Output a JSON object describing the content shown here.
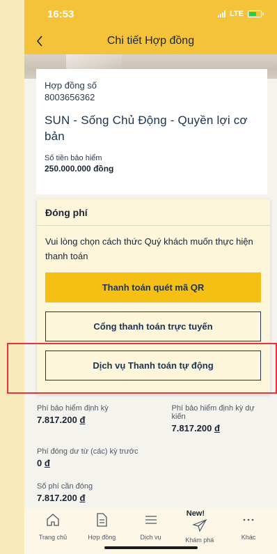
{
  "status_bar": {
    "time": "16:53",
    "network": "LTE"
  },
  "nav": {
    "title": "Chi tiết Hợp đồng"
  },
  "contract": {
    "number_label": "Hợp đồng số",
    "number": "8003656362",
    "product": "SUN - Sống Chủ Động - Quyền lợi cơ bản",
    "sum_label": "Số tiền bảo hiểm",
    "sum_value": "250.000.000 đồng"
  },
  "modal": {
    "title": "Đóng phí",
    "message": "Vui lòng chọn cách thức Quý khách muốn thực hiện thanh toán",
    "btn_qr": "Thanh toán quét mã QR",
    "btn_online": "Cổng thanh toán trực tuyến",
    "btn_auto": "Dịch vụ Thanh toán tự động"
  },
  "fees": {
    "periodic_label": "Phí bảo hiểm định kỳ",
    "periodic_value": "7.817.200",
    "expected_label": "Phí bảo hiểm định kỳ dự kiến",
    "expected_value": "7.817.200",
    "surplus_label": "Phí đóng dư từ (các) kỳ trước",
    "surplus_value": "0",
    "due_label": "Số phí cần đóng",
    "due_value": "7.817.200",
    "currency": "đ"
  },
  "tabs": [
    {
      "label": "Trang chủ",
      "icon": "home-icon"
    },
    {
      "label": "Hợp đồng",
      "icon": "document-icon"
    },
    {
      "label": "Dịch vụ",
      "icon": "list-icon"
    },
    {
      "label": "Khám phá",
      "icon": "paper-plane-icon",
      "badge": "New!"
    },
    {
      "label": "Khác",
      "icon": "more-icon"
    }
  ],
  "colors": {
    "brand_yellow": "#f5c33a",
    "button_yellow": "#f5bf14",
    "navy": "#1a3350",
    "highlight_red": "#e8333a"
  }
}
